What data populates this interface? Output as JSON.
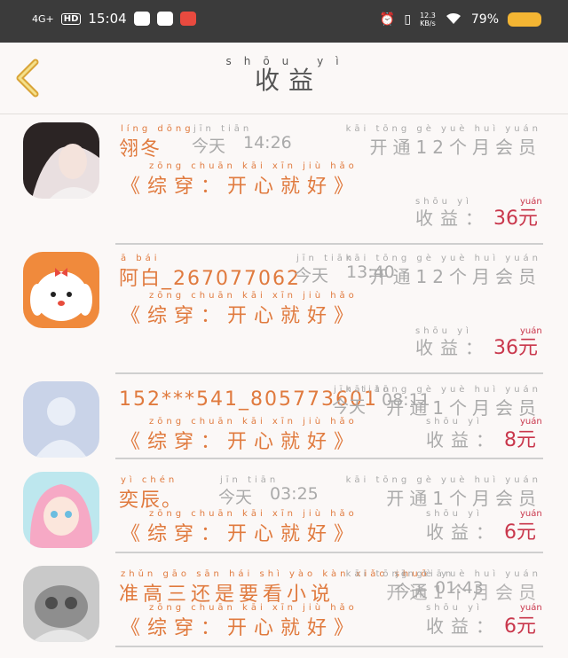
{
  "status_bar": {
    "network": "4G+",
    "hd": "HD",
    "time": "15:04",
    "net_speed_value": "12.3",
    "net_speed_unit": "KB/s",
    "battery": "79%"
  },
  "header": {
    "title": "收益",
    "title_pinyin": "shōu yì"
  },
  "items": [
    {
      "name": "翎冬",
      "name_pinyin": "líng dōng",
      "time_label": "今天",
      "time_label_pinyin": "jīn tiān",
      "time": "14:26",
      "desc": "开通12个月会员",
      "desc_pinyin": "kāi tōng  gè yuè huì yuán",
      "novel": "《综穿：开心就好》",
      "novel_pinyin": "zōng chuān   kāi xīn jiù  hǎo",
      "earn_label": "收益：",
      "earn_label_pinyin": "shōu yì",
      "amount": "36元",
      "amount_pinyin": "yuán"
    },
    {
      "name": "阿白_267077062",
      "name_pinyin": "ā bái",
      "time_label": "今天",
      "time_label_pinyin": "jīn tiān",
      "time": "13:40",
      "desc": "开通12个月会员",
      "desc_pinyin": "kāi tōng  gè yuè huì yuán",
      "novel": "《综穿：开心就好》",
      "novel_pinyin": "zōng chuān   kāi xīn jiù  hǎo",
      "earn_label": "收益：",
      "earn_label_pinyin": "shōu yì",
      "amount": "36元",
      "amount_pinyin": "yuán"
    },
    {
      "name": "152***541_805773601",
      "name_pinyin": "",
      "time_label": "今天",
      "time_label_pinyin": "jīn tiān",
      "time": "08:11",
      "desc": "开通1个月会员",
      "desc_pinyin": "kāi tōng  gè yuè huì yuán",
      "novel": "《综穿：开心就好》",
      "novel_pinyin": "zōng chuān   kāi xīn jiù hǎo",
      "earn_label": "收益：",
      "earn_label_pinyin": "shōu yì",
      "amount": "8元",
      "amount_pinyin": "yuán"
    },
    {
      "name": "奕辰。",
      "name_pinyin": "yì chén",
      "time_label": "今天",
      "time_label_pinyin": "jīn tiān",
      "time": "03:25",
      "desc": "开通1个月会员",
      "desc_pinyin": "kāi tōng  gè yuè huì yuán",
      "novel": "《综穿：开心就好》",
      "novel_pinyin": "zōng chuān   kāi xīn jiù hǎo",
      "earn_label": "收益：",
      "earn_label_pinyin": "shōu yì",
      "amount": "6元",
      "amount_pinyin": "yuán"
    },
    {
      "name": "准高三还是要看小说",
      "name_pinyin": "zhǔn gāo sān hái shì yào kàn xiǎo shuō",
      "time_label": "今天",
      "time_label_pinyin": "jīn tiān",
      "time": "01:43",
      "desc": "开通1个月会员",
      "desc_pinyin": "kāi tōng  gè yuè huì yuán",
      "novel": "《综穿：开心就好》",
      "novel_pinyin": "zōng chuān   kāi xīn jiù hǎo",
      "earn_label": "收益：",
      "earn_label_pinyin": "shōu yì",
      "amount": "6元",
      "amount_pinyin": "yuán"
    }
  ],
  "colors": {
    "status_bg": "#3b3b3b",
    "accent_orange": "#e07a3e",
    "amount_red": "#c9374c",
    "back_arrow": "#d9a437"
  }
}
